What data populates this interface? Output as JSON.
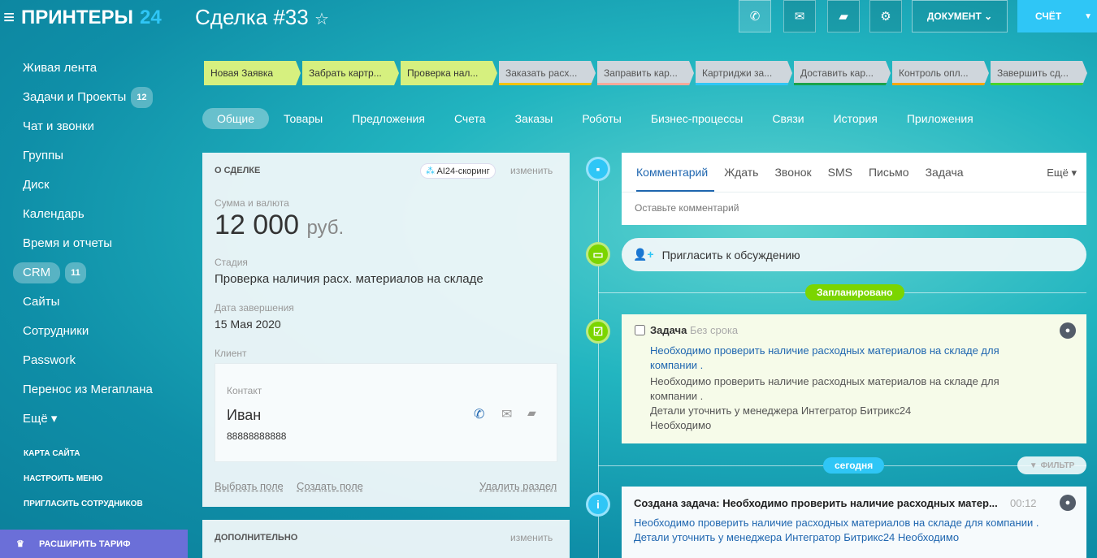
{
  "logo": {
    "name": "ПРИНТЕРЫ",
    "num": "24"
  },
  "sidebar": {
    "items": [
      {
        "label": "Живая лента"
      },
      {
        "label": "Задачи и Проекты",
        "count": "12"
      },
      {
        "label": "Чат и звонки"
      },
      {
        "label": "Группы"
      },
      {
        "label": "Диск"
      },
      {
        "label": "Календарь"
      },
      {
        "label": "Время и отчеты"
      },
      {
        "label": "CRM",
        "count": "11"
      },
      {
        "label": "Сайты"
      },
      {
        "label": "Сотрудники"
      },
      {
        "label": "Passwork"
      },
      {
        "label": "Перенос из Мегаплана"
      },
      {
        "label": "Ещё ▾"
      }
    ],
    "links": [
      "КАРТА САЙТА",
      "НАСТРОИТЬ МЕНЮ",
      "ПРИГЛАСИТЬ СОТРУДНИКОВ"
    ],
    "tariff": "РАСШИРИТЬ ТАРИФ"
  },
  "header": {
    "title": "Сделка #33",
    "doc": "ДОКУМЕНТ",
    "invoice": "СЧЁТ"
  },
  "stages": [
    {
      "label": "Новая Заявка",
      "active": true
    },
    {
      "label": "Забрать картр...",
      "active": true
    },
    {
      "label": "Проверка нал...",
      "active": true
    },
    {
      "label": "Заказать расх...",
      "color": "#f2c200"
    },
    {
      "label": "Заправить кар...",
      "color": "#f7a99a"
    },
    {
      "label": "Картриджи за...",
      "color": "#2fc6f6"
    },
    {
      "label": "Доставить кар...",
      "color": "#1aa34a"
    },
    {
      "label": "Контроль опл...",
      "color": "#f7a700"
    },
    {
      "label": "Завершить сд...",
      "color": "#47d22c"
    }
  ],
  "tabs": [
    "Общие",
    "Товары",
    "Предложения",
    "Счета",
    "Заказы",
    "Роботы",
    "Бизнес-процессы",
    "Связи",
    "История",
    "Приложения"
  ],
  "deal": {
    "heading": "О СДЕЛКЕ",
    "scoring": "AI24-скоринг",
    "edit": "изменить",
    "sum_label": "Сумма и валюта",
    "sum": "12 000",
    "currency": "руб.",
    "stage_label": "Стадия",
    "stage": "Проверка наличия расх. материалов на складе",
    "date_label": "Дата завершения",
    "date": "15 Мая 2020",
    "client_label": "Клиент",
    "contact_label": "Контакт",
    "contact_name": "Иван",
    "phone": "88888888888",
    "select_field": "Выбрать поле",
    "create_field": "Создать поле",
    "delete_section": "Удалить раздел",
    "extra_heading": "ДОПОЛНИТЕЛЬНО",
    "extra_edit": "изменить"
  },
  "activity": {
    "tabs": [
      "Комментарий",
      "Ждать",
      "Звонок",
      "SMS",
      "Письмо",
      "Задача"
    ],
    "more": "Ещё ▾",
    "placeholder": "Оставьте комментарий",
    "invite": "Пригласить к обсуждению",
    "planned": "Запланировано",
    "today": "сегодня",
    "filter": "ФИЛЬТР"
  },
  "task": {
    "title": "Задача",
    "deadline": "Без срока",
    "link": "Необходимо проверить наличие расходных материалов на складе для компании .",
    "text1": "Необходимо проверить наличие расходных материалов на складе для компании .",
    "text2": "Детали уточнить у менеджера Интегратор Битрикс24",
    "text3": "Необходимо"
  },
  "event": {
    "title": "Создана задача: Необходимо проверить наличие расходных матер...",
    "time": "00:12",
    "line1": "Необходимо проверить наличие расходных материалов на складе для компании .",
    "line2": "Детали уточнить у менеджера Интегратор Битрикс24 Необходимо"
  }
}
